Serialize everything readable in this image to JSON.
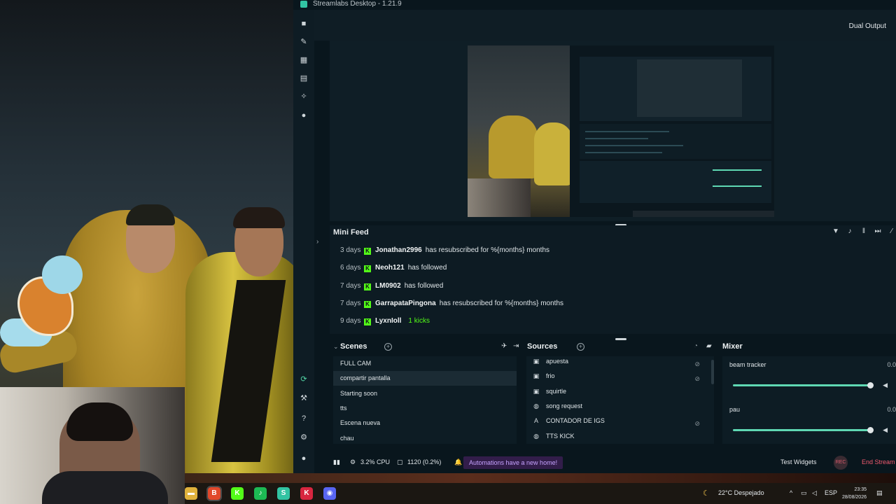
{
  "window": {
    "title": "Streamlabs Desktop - 1.21.9"
  },
  "header": {
    "dual_output_label": "Dual Output"
  },
  "mini_feed": {
    "title": "Mini Feed",
    "events": [
      {
        "age": "3 days",
        "user": "Jonathan2996",
        "text": "has resubscribed for %{months} months",
        "extra": ""
      },
      {
        "age": "6 days",
        "user": "Neoh121",
        "text": "has followed",
        "extra": ""
      },
      {
        "age": "7 days",
        "user": "LM0902",
        "text": "has followed",
        "extra": ""
      },
      {
        "age": "7 days",
        "user": "GarrapataPingona",
        "text": "has resubscribed for %{months} months",
        "extra": ""
      },
      {
        "age": "9 days",
        "user": "LyxnIoll",
        "text": "",
        "extra": "1 kicks"
      }
    ]
  },
  "scenes": {
    "title": "Scenes",
    "items": [
      "FULL CAM",
      "compartir pantalla",
      "Starting soon",
      "tts",
      "Escena nueva",
      "chau"
    ],
    "selected_index": 1
  },
  "sources": {
    "title": "Sources",
    "items": [
      {
        "label": "apuesta",
        "icon": "image-icon",
        "glyph": "▣",
        "flag": "⊘"
      },
      {
        "label": "frio",
        "icon": "image-icon",
        "glyph": "▣",
        "flag": "⊘"
      },
      {
        "label": "squirtle",
        "icon": "image-icon",
        "glyph": "▣",
        "flag": ""
      },
      {
        "label": "song request",
        "icon": "globe-icon",
        "glyph": "◍",
        "flag": ""
      },
      {
        "label": "CONTADOR DE IGS",
        "icon": "text-icon",
        "glyph": "A",
        "flag": "⊘"
      },
      {
        "label": "TTS KICK",
        "icon": "globe-icon",
        "glyph": "◍",
        "flag": ""
      }
    ]
  },
  "mixer": {
    "title": "Mixer",
    "channels": [
      {
        "label": "beam tracker",
        "value": "0.0",
        "level": 1.0
      },
      {
        "label": "pau",
        "value": "0.0",
        "level": 1.0
      }
    ]
  },
  "footer": {
    "cpu": "3.2% CPU",
    "resolution": "1120 (0.2%)",
    "automations": "Automations have a new home!",
    "test_widgets": "Test Widgets",
    "live_badge": "REC",
    "end_stream": "End Stream"
  },
  "taskbar": {
    "apps": [
      {
        "icon": "file-explorer-icon",
        "glyph": "▬",
        "color": "#e0b23c"
      },
      {
        "icon": "brave-icon",
        "glyph": "B",
        "color": "#e1482b"
      },
      {
        "icon": "kick-icon",
        "glyph": "K",
        "color": "#53fc18"
      },
      {
        "icon": "spotify-icon",
        "glyph": "♪",
        "color": "#1db954"
      },
      {
        "icon": "streamlabs-icon",
        "glyph": "S",
        "color": "#31c3a2"
      },
      {
        "icon": "kick-studio-icon",
        "glyph": "K",
        "color": "#d8263f"
      },
      {
        "icon": "discord-icon",
        "glyph": "◉",
        "color": "#5865f2"
      }
    ],
    "weather": "22°C  Despejado",
    "language": "ESP",
    "time": "23:35",
    "date": "28/08/2026"
  },
  "colors": {
    "accent": "#31c3a2",
    "kick_green": "#53fc18",
    "end_stream": "#ef5a6f"
  }
}
